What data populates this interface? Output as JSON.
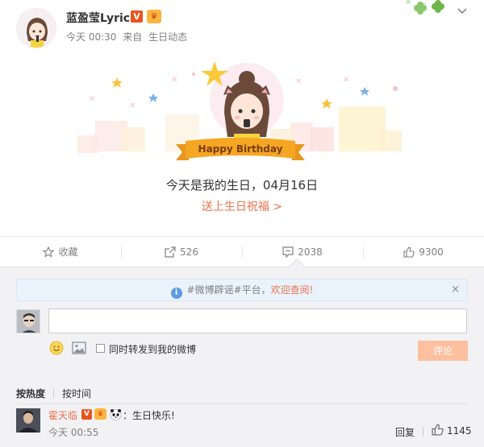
{
  "post": {
    "username": "蓝盈莹Lyric",
    "verified_badge": "V",
    "meta_time": "今天 00:30",
    "meta_from": "来自",
    "meta_source": "生日动态"
  },
  "card": {
    "banner_text": "Happy Birthday",
    "birthday_text": "今天是我的生日，04月16日",
    "send_wishes_link": "送上生日祝福 >"
  },
  "actions": {
    "favorite_label": "收藏",
    "repost_count": "526",
    "comment_count": "2038",
    "like_count": "9300"
  },
  "comment_box": {
    "notice_prefix": "#微博辟谣#平台，",
    "notice_link": "欢迎查阅!",
    "notice_close": "×",
    "input_value": "",
    "forward_checkbox_label": "同时转发到我的微博",
    "forward_checked": false,
    "submit_label": "评论"
  },
  "sort": {
    "hot_label": "按热度",
    "time_label": "按时间"
  },
  "comment": {
    "name": "霍天临",
    "verified_badge": "V",
    "text": "：生日快乐!",
    "time": "今天 00:55",
    "reply_label": "回复",
    "like_count": "1145"
  },
  "colors": {
    "accent": "#eb7350",
    "submit_disabled": "#ffc09f",
    "badge_orange": "#e8541e",
    "notice_bg": "#eaf2fb",
    "comment_bg": "#f2f2f5",
    "banner": "#f5a623"
  },
  "icons": {
    "favorite": "star-outline-icon",
    "repost": "share-box-icon",
    "comment": "comment-bubble-icon",
    "like": "thumbs-up-icon",
    "notice": "info-icon",
    "emoji": "smiley-icon",
    "picture": "picture-icon",
    "collapse": "chevron-down-icon"
  }
}
